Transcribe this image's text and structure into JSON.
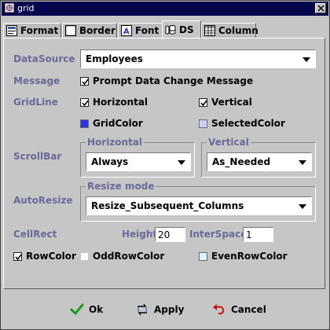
{
  "window": {
    "title": "grid"
  },
  "tabs": [
    {
      "label": "Format",
      "icon": "format-icon",
      "active": false
    },
    {
      "label": "Border",
      "icon": "border-icon",
      "active": false
    },
    {
      "label": "Font",
      "icon": "font-icon",
      "active": false
    },
    {
      "label": "DS",
      "icon": "datasource-icon",
      "active": true
    },
    {
      "label": "Column",
      "icon": "column-table-icon",
      "active": false
    }
  ],
  "datasource": {
    "label": "DataSource",
    "value": "Employees"
  },
  "message": {
    "label": "Message",
    "checkbox_label": "Prompt Data Change Message",
    "checked": true
  },
  "gridline": {
    "label": "GridLine",
    "horizontal": {
      "label": "Horizontal",
      "checked": true
    },
    "vertical": {
      "label": "Vertical",
      "checked": true
    },
    "grid_color": {
      "label": "GridColor",
      "color": "#3030ee"
    },
    "selected_color": {
      "label": "SelectedColor",
      "color": "#cfcff3"
    }
  },
  "scrollbar": {
    "label": "ScrollBar",
    "horizontal": {
      "group_title": "Horizontal",
      "value": "Always"
    },
    "vertical": {
      "group_title": "Vertical",
      "value": "As_Needed"
    }
  },
  "autoresize": {
    "label": "AutoResize",
    "group_title": "Resize mode",
    "value": "Resize_Subsequent_Columns"
  },
  "cellrect": {
    "label": "CellRect",
    "height_label": "Height",
    "height_value": "20",
    "interspace_label": "InterSpace",
    "interspace_value": "1"
  },
  "rowcolors": {
    "row_color": {
      "label": "RowColor",
      "checked": true
    },
    "odd_row_color": {
      "label": "OddRowColor",
      "color": "#ffffff"
    },
    "even_row_color": {
      "label": "EvenRowColor",
      "color": "#dafafa"
    }
  },
  "buttons": {
    "ok": "Ok",
    "apply": "Apply",
    "cancel": "Cancel"
  },
  "colors": {
    "title_bar": "#06064f",
    "label_text": "#6a6a9a",
    "ok_check": "#1a9a1a",
    "cancel_arrow": "#d01010"
  }
}
